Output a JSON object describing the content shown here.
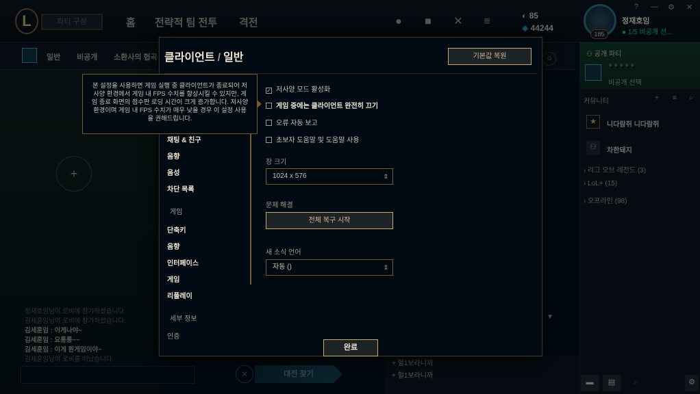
{
  "topnav": {
    "play_label": "파티 구성",
    "links": [
      "홈",
      "전략적 팀 전투",
      "격전"
    ],
    "rp": "85",
    "be": "44244",
    "username": "정재호임",
    "status": "1/5 비공개 선...",
    "level": "185",
    "window_controls": [
      "?",
      "—",
      "⚙",
      "✕"
    ]
  },
  "subnav": {
    "items": [
      "일반",
      "비공개",
      "소환사의 협곡"
    ]
  },
  "chat": {
    "lines": [
      {
        "text": "정재호임님이 로비에 참가하셨습니다.",
        "strong": false
      },
      {
        "text": "김세훈임님이 로비에 참가하셨습니다.",
        "strong": false
      },
      {
        "text": "김세훈임 : 이게나야~",
        "strong": true
      },
      {
        "text": "김세훈임 : 요롱롱~~",
        "strong": true
      },
      {
        "text": "김세훈임 : 이게 뭔게임이야~",
        "strong": true
      },
      {
        "text": "김세훈임님이 로비를 떠났습니다.",
        "strong": false
      }
    ],
    "find_match": "대전 찾기"
  },
  "social": {
    "party_label": "공개 파티",
    "party_sub": "비공개 선택",
    "community": "커뮤니티",
    "friends": [
      {
        "name": "니다람쥐 니다람쥐"
      },
      {
        "name": "차한돼지"
      }
    ],
    "groups": [
      "리그 오브 레전드 (3)",
      "LoL+ (15)",
      "오프라인 (98)"
    ],
    "bottom_items": [
      "헐1보라니까",
      "헐1보라니까"
    ]
  },
  "modal": {
    "title_section": "클라이언트",
    "title_page": "일반",
    "restore_label": "기본값 복원",
    "menu": [
      {
        "label": "채팅 & 친구",
        "type": "item"
      },
      {
        "label": "음향",
        "type": "item"
      },
      {
        "label": "음성",
        "type": "item"
      },
      {
        "label": "차단 목록",
        "type": "item"
      },
      {
        "label": "게임",
        "type": "header"
      },
      {
        "label": "단축키",
        "type": "item"
      },
      {
        "label": "음향",
        "type": "item"
      },
      {
        "label": "인터페이스",
        "type": "item"
      },
      {
        "label": "게임",
        "type": "item"
      },
      {
        "label": "리플레이",
        "type": "item"
      },
      {
        "label": "세부 정보",
        "type": "header"
      },
      {
        "label": "인증",
        "type": "item"
      }
    ],
    "checkboxes": [
      {
        "label": "저사양 모드 활성화",
        "checked": true,
        "bold": false
      },
      {
        "label": "게임 중에는 클라이언트 완전히 끄기",
        "checked": false,
        "bold": true
      },
      {
        "label": "오류 자동 보고",
        "checked": false,
        "bold": false
      },
      {
        "label": "초보자 도움말 및 도움말 사용",
        "checked": false,
        "bold": false
      }
    ],
    "window_size_label": "창 크기",
    "window_size_value": "1024 x 576",
    "troubleshoot_label": "문제 해결",
    "repair_label": "전체 복구 시작",
    "news_lang_label": "새 소식 언어",
    "news_lang_value": "자동 ()",
    "done_label": "완료"
  },
  "tooltip": {
    "text": "본 설정을 사용하면 게임 실행 중 클라이언트가 종료되어 저사양 환경에서 게임 내 FPS 수치를 향상시킬 수 있지만, 게임 종료 화면의 점수판 로딩 시간이 크게 증가합니다. 저사양 환경이며 게임 내 FPS 수치가 매우 낮을 경우 이 설정 사용을 권해드립니다."
  },
  "colors": {
    "gold": "#c8aa6e",
    "gold_dark": "#785a28",
    "bg": "#010a13",
    "online": "#0acf83"
  }
}
